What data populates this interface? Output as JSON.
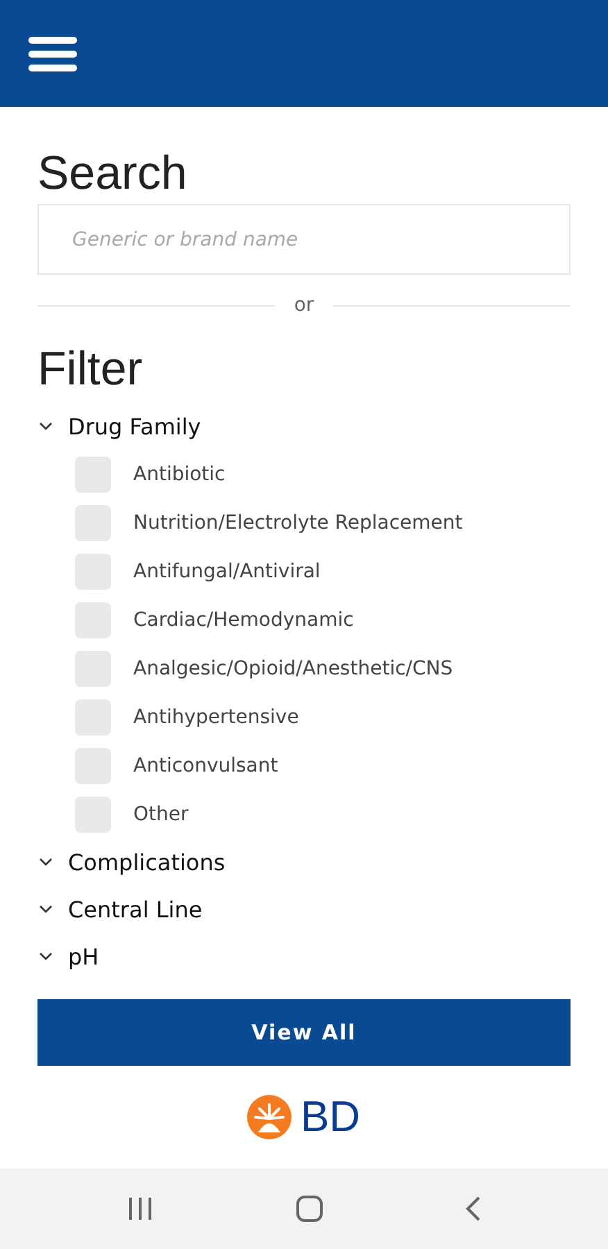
{
  "search": {
    "title": "Search",
    "placeholder": "Generic or brand name"
  },
  "divider_text": "or",
  "filter": {
    "title": "Filter",
    "sections": [
      {
        "label": "Drug Family",
        "options": [
          {
            "label": "Antibiotic",
            "checked": false
          },
          {
            "label": "Nutrition/Electrolyte Replacement",
            "checked": false
          },
          {
            "label": "Antifungal/Antiviral",
            "checked": false
          },
          {
            "label": "Cardiac/Hemodynamic",
            "checked": false
          },
          {
            "label": "Analgesic/Opioid/Anesthetic/CNS",
            "checked": false
          },
          {
            "label": "Antihypertensive",
            "checked": false
          },
          {
            "label": "Anticonvulsant",
            "checked": false
          },
          {
            "label": "Other",
            "checked": false
          }
        ]
      },
      {
        "label": "Complications"
      },
      {
        "label": "Central Line"
      },
      {
        "label": "pH"
      }
    ]
  },
  "button": "View All",
  "logo": "BD"
}
